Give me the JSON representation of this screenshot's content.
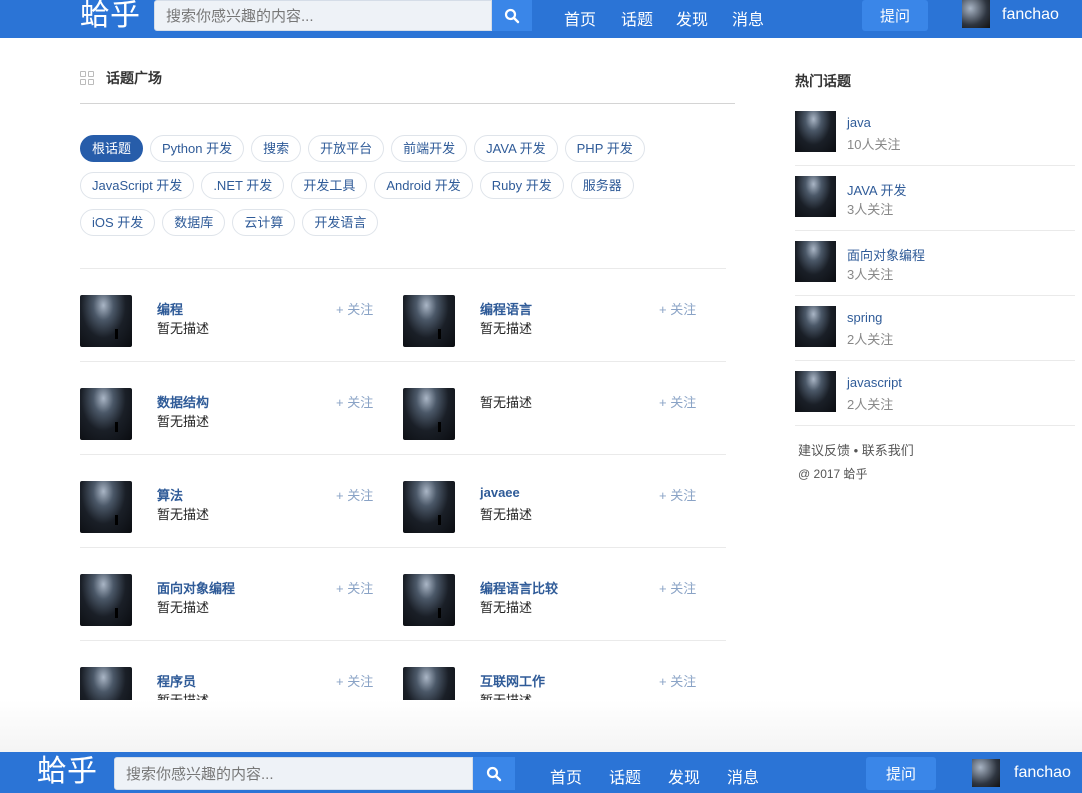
{
  "header": {
    "logo": "蛤乎",
    "search_placeholder": "搜索你感兴趣的内容...",
    "nav": [
      "首页",
      "话题",
      "发现",
      "消息"
    ],
    "ask": "提问",
    "username": "fanchao"
  },
  "main": {
    "section_title": "话题广场",
    "tags": [
      "根话题",
      "Python 开发",
      "搜索",
      "开放平台",
      "前端开发",
      "JAVA 开发",
      "PHP 开发",
      "JavaScript 开发",
      ".NET 开发",
      "开发工具",
      "Android 开发",
      "Ruby 开发",
      "服务器",
      "iOS 开发",
      "数据库",
      "云计算",
      "开发语言"
    ],
    "follow_label": "+ 关注",
    "topics": [
      {
        "name": "编程",
        "desc": "暂无描述"
      },
      {
        "name": "编程语言",
        "desc": "暂无描述"
      },
      {
        "name": "数据结构",
        "desc": "暂无描述"
      },
      {
        "name": "",
        "desc": "暂无描述"
      },
      {
        "name": "算法",
        "desc": "暂无描述"
      },
      {
        "name": "javaee",
        "desc": "暂无描述"
      },
      {
        "name": "面向对象编程",
        "desc": "暂无描述"
      },
      {
        "name": "编程语言比较",
        "desc": "暂无描述"
      },
      {
        "name": "程序员",
        "desc": "暂无描述"
      },
      {
        "name": "互联网工作",
        "desc": "暂无描述"
      }
    ]
  },
  "sidebar": {
    "title": "热门话题",
    "items": [
      {
        "name": "java",
        "count": "10人关注"
      },
      {
        "name": "JAVA 开发",
        "count": "3人关注"
      },
      {
        "name": "面向对象编程",
        "count": "3人关注"
      },
      {
        "name": "spring",
        "count": "2人关注"
      },
      {
        "name": "javascript",
        "count": "2人关注"
      }
    ],
    "footer_links": "建议反馈 • 联系我们",
    "copyright": "@ 2017 蛤乎"
  }
}
